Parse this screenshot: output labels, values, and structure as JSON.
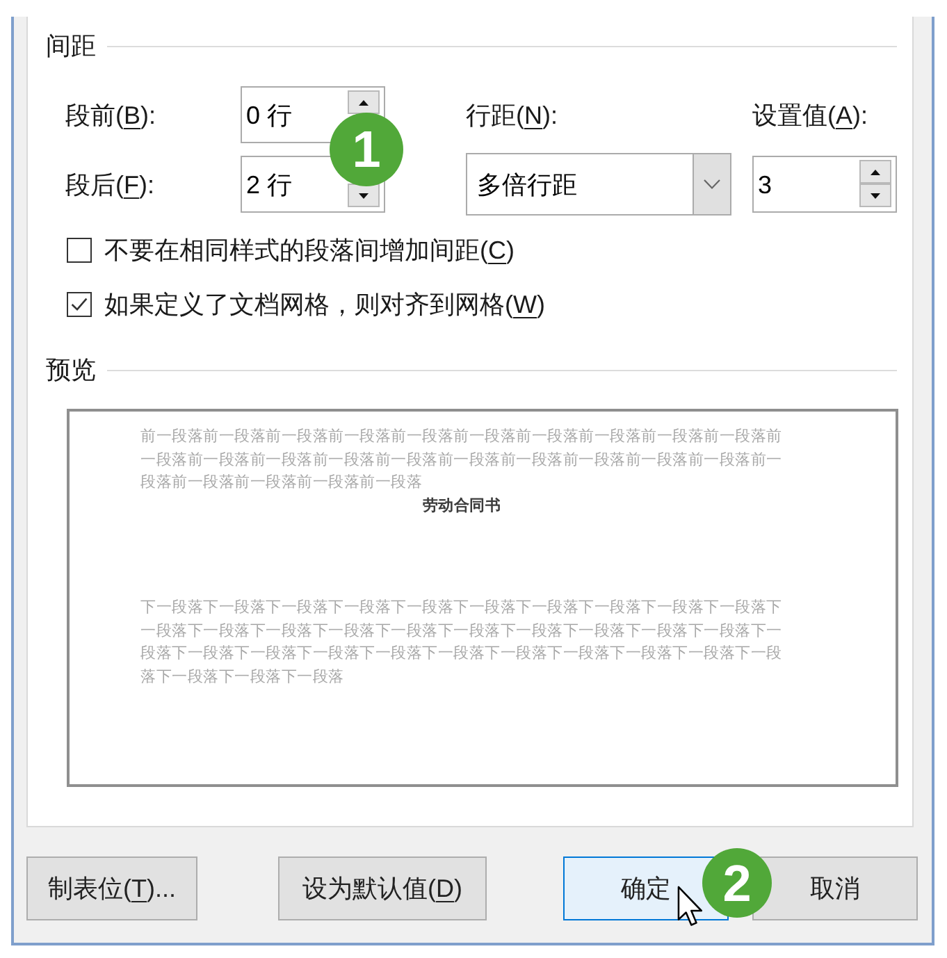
{
  "spacing": {
    "title": "间距",
    "before": {
      "label": {
        "start": "段前(",
        "key": "B",
        "end": "):"
      },
      "value": "0 行"
    },
    "after": {
      "label": {
        "start": "段后(",
        "key": "F",
        "end": "):"
      },
      "value": "2 行"
    },
    "line_spacing": {
      "label": {
        "start": "行距(",
        "key": "N",
        "end": "):"
      },
      "value": "多倍行距"
    },
    "at": {
      "label": {
        "start": "设置值(",
        "key": "A",
        "end": "):"
      },
      "value": "3"
    },
    "checkboxes": [
      {
        "label": {
          "start": "不要在相同样式的段落间增加间距(",
          "key": "C",
          "end": ")"
        },
        "checked": false
      },
      {
        "label": {
          "start": "如果定义了文档网格，则对齐到网格(",
          "key": "W",
          "end": ")"
        },
        "checked": true
      }
    ]
  },
  "preview": {
    "title": "预览",
    "previous_paragraph": "前一段落前一段落前一段落前一段落前一段落前一段落前一段落前一段落前一段落前一段落前一段落前一段落前一段落前一段落前一段落前一段落前一段落前一段落前一段落前一段落前一段落前一段落前一段落前一段落前一段落",
    "sample": "劳动合同书",
    "next_paragraph": "下一段落下一段落下一段落下一段落下一段落下一段落下一段落下一段落下一段落下一段落下一段落下一段落下一段落下一段落下一段落下一段落下一段落下一段落下一段落下一段落下一段落下一段落下一段落下一段落下一段落下一段落下一段落下一段落下一段落下一段落下一段落下一段落下一段落下一段落"
  },
  "buttons": [
    {
      "label": {
        "start": "制表位(",
        "key": "T",
        "end": ")..."
      },
      "focused": false
    },
    {
      "label": {
        "start": "设为默认值(",
        "key": "D",
        "end": ")"
      },
      "focused": false
    },
    {
      "label": {
        "start": "确定"
      },
      "focused": true
    },
    {
      "label": {
        "start": "取消"
      },
      "focused": false
    }
  ],
  "callouts": [
    {
      "label": "1"
    },
    {
      "label": "2"
    }
  ]
}
